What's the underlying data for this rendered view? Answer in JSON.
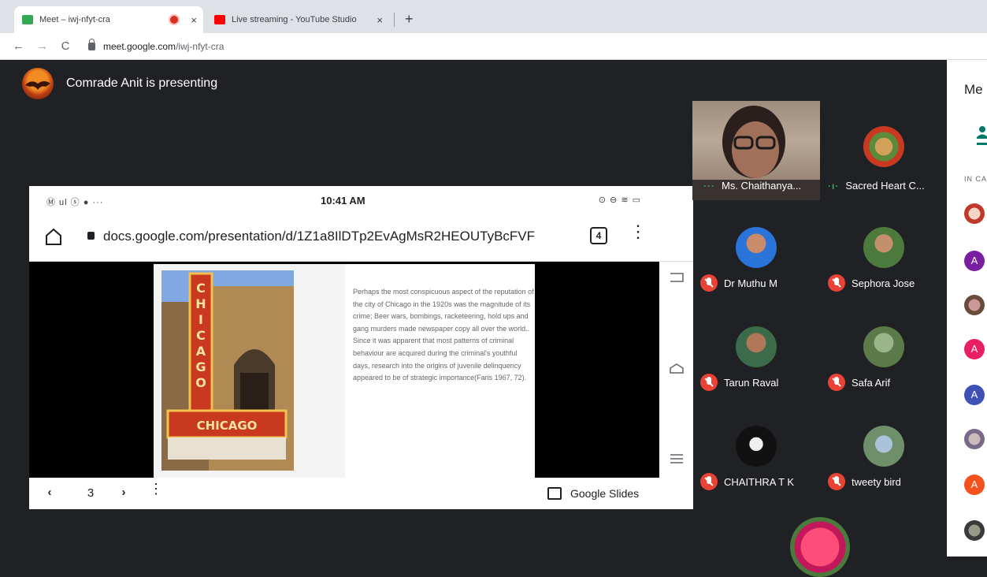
{
  "browser": {
    "tabs": [
      {
        "title": "Meet – iwj-nfyt-cra",
        "close": "×"
      },
      {
        "title": "Live streaming - YouTube Studio",
        "close": "×"
      }
    ],
    "new_tab": "+",
    "url_domain": "meet.google.com",
    "url_path": "/iwj-nfyt-cra",
    "back": "←",
    "forward": "→",
    "reload": "C"
  },
  "meet": {
    "presenter_text": "Comrade Anit is presenting",
    "participants": [
      {
        "name": "Ms. Chaithanya...",
        "state": "speaking"
      },
      {
        "name": "Sacred Heart C...",
        "state": "speaking"
      },
      {
        "name": "Dr Muthu M",
        "state": "muted"
      },
      {
        "name": "Sephora Jose",
        "state": "muted"
      },
      {
        "name": "Tarun Raval",
        "state": "muted"
      },
      {
        "name": "Safa Arif",
        "state": "muted"
      },
      {
        "name": "CHAITHRA T K",
        "state": "muted"
      },
      {
        "name": "tweety bird",
        "state": "muted"
      }
    ],
    "side_panel": {
      "title": "Me",
      "section": "IN CA",
      "avatar_letters": [
        "A",
        "A",
        "A",
        "A"
      ]
    }
  },
  "shared_screen": {
    "status_left": "Ⓜ ul ⓢ ● ···",
    "time": "10:41 AM",
    "status_right": "⊙ ⊖ ≋ ▭",
    "doc_url": "docs.google.com/presentation/d/1Z1a8IlDTp2EvAgMsR2HEOUTyBcFVF",
    "tab_count": "4",
    "menu": "⋮",
    "slide_text": "Perhaps the most conspicuous aspect of the reputation of the city of Chicago in the 1920s was the magnitude of its crime; Beer wars, bombings, racketeering, hold ups and gang murders made newspaper copy all over the world.. Since it was apparent that most patterns of criminal behaviour are acquired during the criminal's youthful days, research into the origins of juvenile delinquency appeared to be of strategic importance(Faris 1967, 72).",
    "image_sign_vertical": "CHICAGO",
    "image_marquee": "CHICAGO",
    "prev": "‹",
    "next": "›",
    "page": "3",
    "more": "⋮",
    "app_label": "Google Slides"
  },
  "colors": {
    "meet_bg": "#202124",
    "muted_red": "#ea4335",
    "speaking_green": "#34a853",
    "avatar_purple": "#7b1fa2",
    "avatar_pink": "#e91e63",
    "avatar_indigo": "#3f51b5",
    "avatar_orange": "#f4511e"
  }
}
